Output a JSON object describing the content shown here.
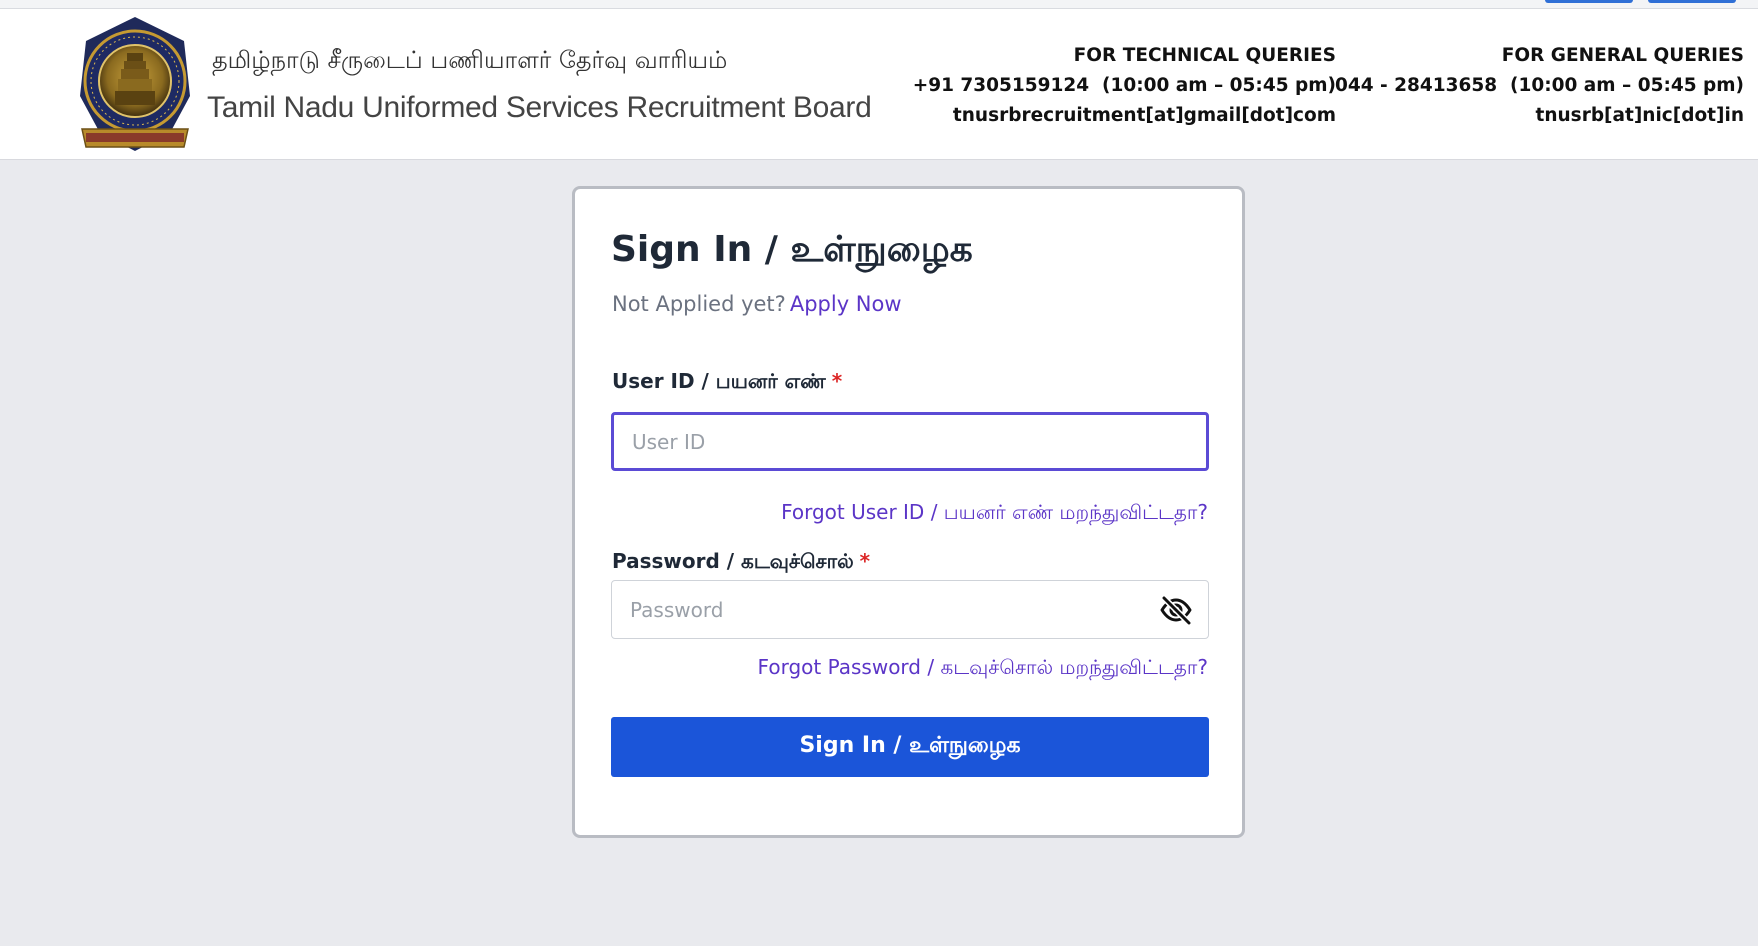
{
  "header": {
    "org_name_tamil": "தமிழ்நாடு சீருடைப் பணியாளர் தேர்வு வாரியம்",
    "org_name_english": "Tamil Nadu Uniformed Services Recruitment Board",
    "technical": {
      "heading": "FOR TECHNICAL QUERIES",
      "phone": "+91 7305159124  (10:00 am – 05:45 pm)",
      "email": "tnusrbrecruitment[at]gmail[dot]com"
    },
    "general": {
      "heading": "FOR GENERAL QUERIES",
      "phone": "044 - 28413658  (10:00 am – 05:45 pm)",
      "email": "tnusrb[at]nic[dot]in"
    }
  },
  "signin": {
    "title": "Sign In / உள்நுழைக",
    "not_applied": "Not Applied yet?",
    "apply_now": "Apply Now",
    "user_label": "User ID / பயனர் எண்",
    "required_mark": "*",
    "user_placeholder": "User ID",
    "user_value": "",
    "forgot_user": "Forgot User ID / பயனர் எண் மறந்துவிட்டதா?",
    "password_label": "Password / கடவுச்சொல்",
    "password_placeholder": "Password",
    "password_value": "",
    "password_toggle_icon": "eye-slash-icon",
    "forgot_password": "Forgot Password / கடவுச்சொல் மறந்துவிட்டதா?",
    "submit": "Sign In / உள்நுழைக"
  },
  "colors": {
    "accent": "#1b55d9",
    "link": "#5b35c7",
    "required": "#dc2626",
    "focus_border": "#5b4bd5",
    "background": "#e9eaee"
  }
}
